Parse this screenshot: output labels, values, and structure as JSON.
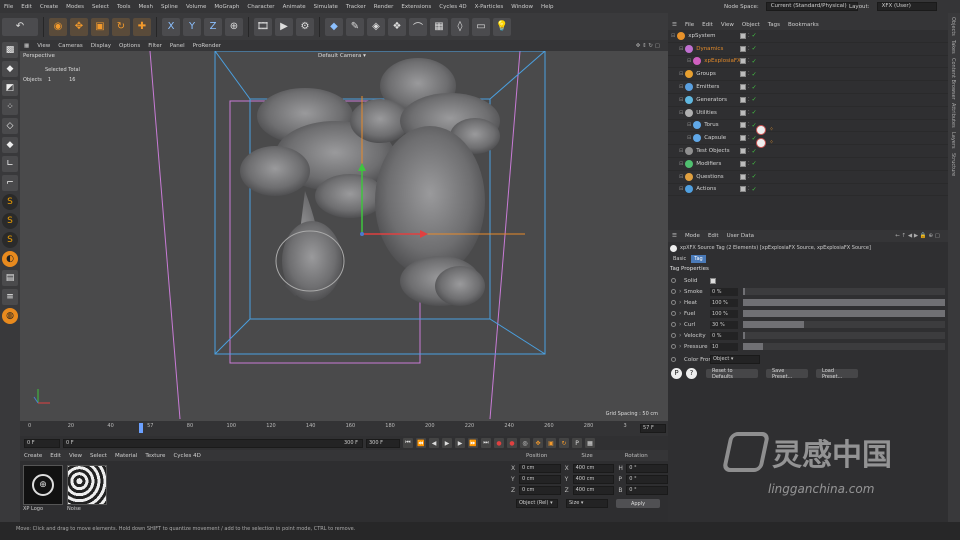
{
  "menubar": {
    "items": [
      "File",
      "Edit",
      "Create",
      "Modes",
      "Select",
      "Tools",
      "Mesh",
      "Spline",
      "Volume",
      "MoGraph",
      "Character",
      "Animate",
      "Simulate",
      "Tracker",
      "Render",
      "Extensions",
      "Cycles 4D",
      "X-Particles",
      "Window",
      "Help"
    ],
    "node_space_label": "Node Space:",
    "node_space_value": "Current (Standard/Physical)",
    "layout_label": "Layout:",
    "layout_value": "XFX (User)"
  },
  "toolbar": {
    "undo": "↶",
    "axis_x": "X",
    "axis_y": "Y",
    "axis_z": "Z"
  },
  "viewport": {
    "menu": [
      "View",
      "Cameras",
      "Display",
      "Options",
      "Filter",
      "Panel",
      "ProRender"
    ],
    "view_name": "Perspective",
    "camera_name": "Default Camera",
    "stats_header": "Selected  Total",
    "stats_label": "Objects",
    "stats_selected": "1",
    "stats_total": "16",
    "grid_spacing": "Grid Spacing : 50 cm"
  },
  "timeline": {
    "ticks": [
      "0",
      "20",
      "40",
      "57",
      "80",
      "100",
      "120",
      "140",
      "160",
      "180",
      "200",
      "220",
      "240",
      "260",
      "280",
      "3"
    ],
    "current_frame": "57 F"
  },
  "transport": {
    "start": "0 F",
    "min": "0 F",
    "max": "300 F",
    "end": "300 F"
  },
  "materials": {
    "menu": [
      "Create",
      "Edit",
      "View",
      "Select",
      "Material",
      "Texture",
      "Cycles 4D"
    ],
    "items": [
      {
        "name": "XP Logo"
      },
      {
        "name": "Noise"
      }
    ]
  },
  "coordinates": {
    "headers": [
      "Position",
      "Size",
      "Rotation"
    ],
    "rows": [
      {
        "axis": "X",
        "pos": "0 cm",
        "size_axis": "X",
        "size": "400 cm",
        "rot_axis": "H",
        "rot": "0 °"
      },
      {
        "axis": "Y",
        "pos": "0 cm",
        "size_axis": "Y",
        "size": "400 cm",
        "rot_axis": "P",
        "rot": "0 °"
      },
      {
        "axis": "Z",
        "pos": "0 cm",
        "size_axis": "Z",
        "size": "400 cm",
        "rot_axis": "B",
        "rot": "0 °"
      }
    ],
    "mode_select": "Object (Rel)",
    "size_select": "Size",
    "apply": "Apply"
  },
  "object_manager": {
    "menu": [
      "File",
      "Edit",
      "View",
      "Object",
      "Tags",
      "Bookmarks"
    ],
    "rows": [
      {
        "name": "xpSystem",
        "indent": 0,
        "color": "#e8922a"
      },
      {
        "name": "Dynamics",
        "indent": 1,
        "color": "#c070d0"
      },
      {
        "name": "xpExplosiaFX",
        "indent": 2,
        "color": "#d060c0"
      },
      {
        "name": "Groups",
        "indent": 1,
        "color": "#e8a030"
      },
      {
        "name": "Emitters",
        "indent": 1,
        "color": "#5aa0e0"
      },
      {
        "name": "Generators",
        "indent": 1,
        "color": "#60b8e0"
      },
      {
        "name": "Utilities",
        "indent": 1,
        "color": "#b0b0b0"
      },
      {
        "name": "Torus",
        "indent": 2,
        "color": "#60a8e8"
      },
      {
        "name": "Capsule",
        "indent": 2,
        "color": "#60a8e8"
      },
      {
        "name": "Test Objects",
        "indent": 1,
        "color": "#909090"
      },
      {
        "name": "Modifiers",
        "indent": 1,
        "color": "#50c070"
      },
      {
        "name": "Questions",
        "indent": 1,
        "color": "#e0a040"
      },
      {
        "name": "Actions",
        "indent": 1,
        "color": "#50a0e0"
      }
    ]
  },
  "attributes": {
    "menu": [
      "Mode",
      "Edit",
      "User Data"
    ],
    "title": "xpXFX Source Tag (2 Elements) [xpExplosiaFX Source, xpExplosiaFX Source]",
    "tabs": [
      "Basic",
      "Tag"
    ],
    "section": "Tag Properties",
    "solid_label": "Solid",
    "params": [
      {
        "label": "Smoke",
        "value": "0 %",
        "level": 0.0
      },
      {
        "label": "Heat",
        "value": "100 %",
        "level": 1.0
      },
      {
        "label": "Fuel",
        "value": "100 %",
        "level": 1.0
      },
      {
        "label": "Curl",
        "value": "30 %",
        "level": 0.3
      },
      {
        "label": "Velocity",
        "value": "0 %",
        "level": 0.0
      },
      {
        "label": "Pressure",
        "value": "10",
        "level": 0.1
      }
    ],
    "color_from_label": "Color From",
    "color_from_value": "Object",
    "reset_button": "Reset to Defaults",
    "save_preset": "Save Preset...",
    "load_preset": "Load Preset..."
  },
  "side_tabs": [
    "Objects",
    "Takes",
    "Content Browser",
    "Attributes",
    "Layers",
    "Structure"
  ],
  "watermark": {
    "cn": "灵感中国",
    "url": "lingganchina.com"
  },
  "status": "Move: Click and drag to move elements. Hold down SHIFT to quantize movement / add to the selection in point mode, CTRL to remove."
}
